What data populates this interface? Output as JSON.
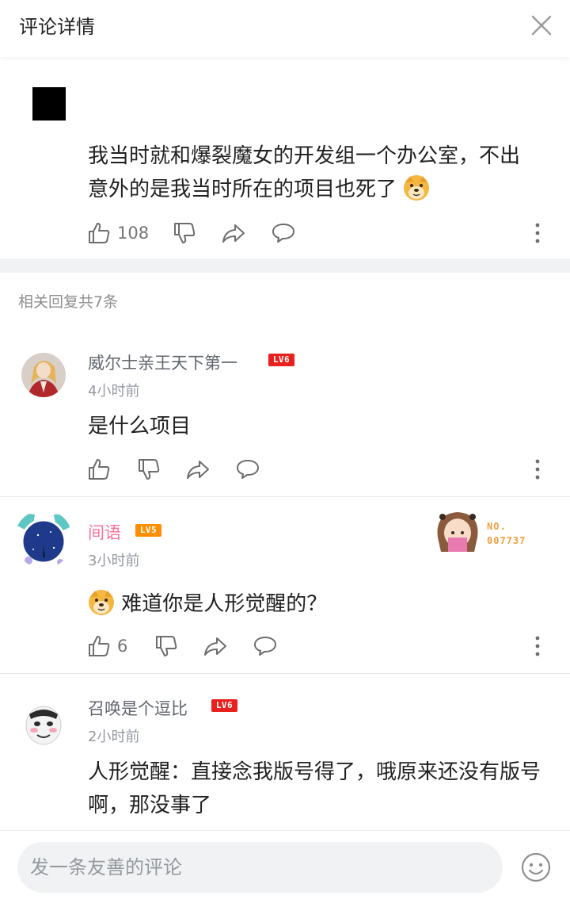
{
  "header": {
    "title": "评论详情"
  },
  "main_comment": {
    "text_line1": "我当时就和爆裂魔女的开发组一个办公室，不出",
    "text_line2": "意外的是我当时所在的项目也死了",
    "emoji": "doge",
    "likes": "108"
  },
  "replies_section": {
    "title": "相关回复共7条"
  },
  "replies": [
    {
      "name": "威尔士亲王天下第一",
      "level": "LV6",
      "time": "4小时前",
      "text": "是什么项目",
      "likes": ""
    },
    {
      "name": "间语",
      "level": "LV5",
      "time": "3小时前",
      "text": "难道你是人形觉醒的？",
      "likes": "6",
      "badge": {
        "line1": "NO.",
        "line2": "007737"
      }
    },
    {
      "name": "召唤是个逗比",
      "level": "LV6",
      "time": "2小时前",
      "text_line1": "人形觉醒：直接念我版号得了，哦原来还没有版号",
      "text_line2": "啊，那没事了"
    }
  ],
  "footer": {
    "placeholder": "发一条友善的评论"
  },
  "colors": {
    "accent_pink": "#fb7299",
    "lv6": "#e8201e",
    "lv5": "#ff8f00",
    "muted": "#9499a0"
  }
}
